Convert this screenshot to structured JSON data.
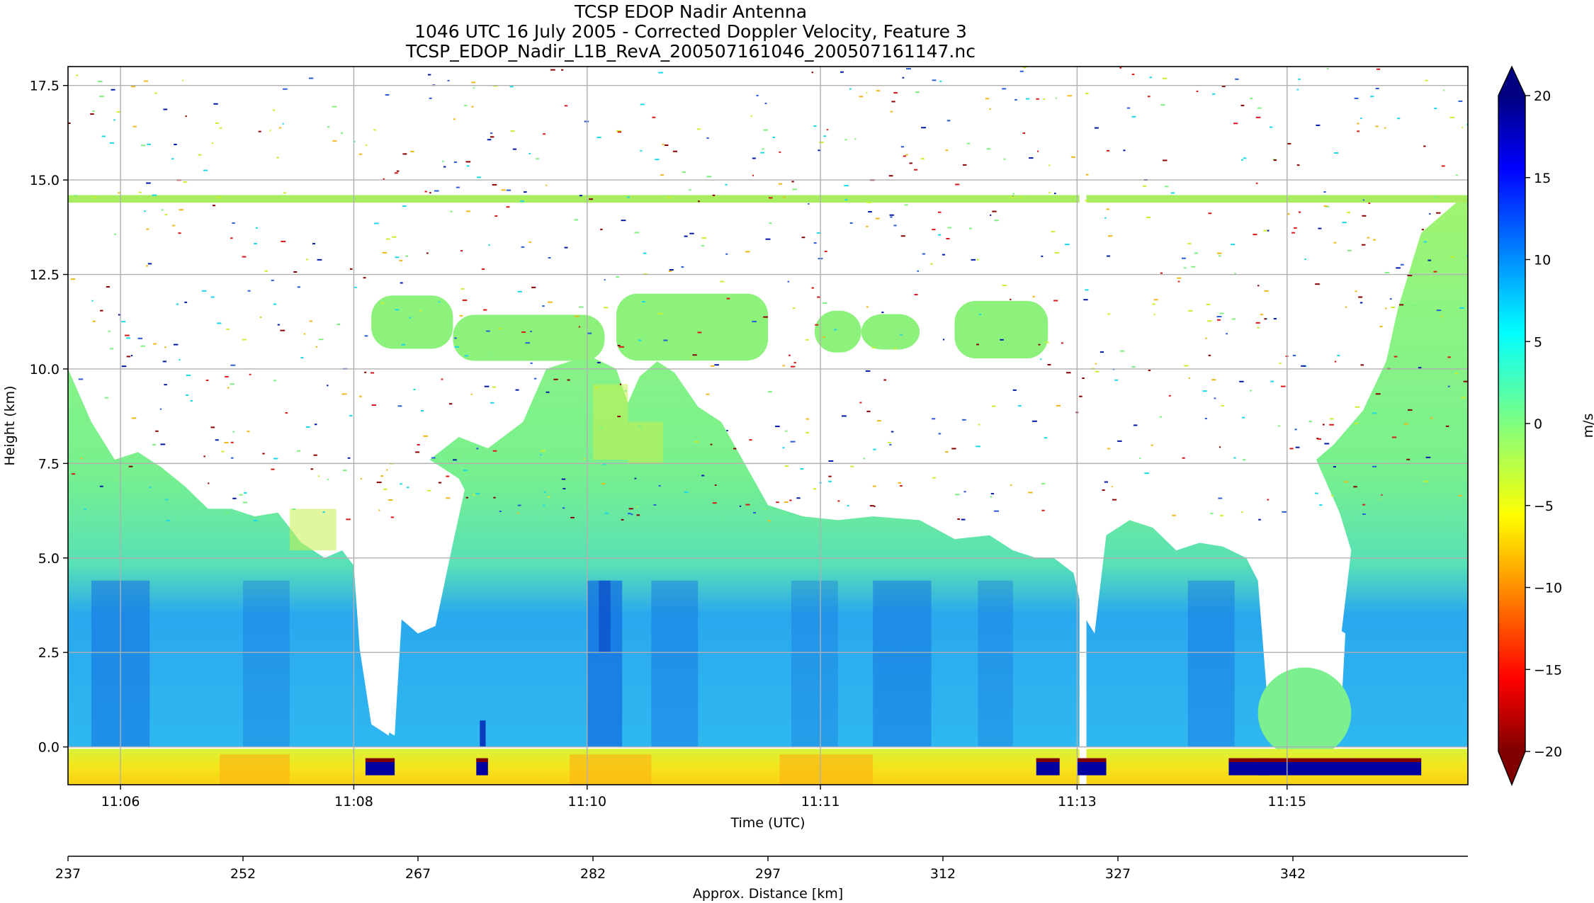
{
  "chart_data": {
    "type": "heatmap",
    "title": [
      "TCSP EDOP Nadir Antenna",
      "1046 UTC 16 July 2005 - Corrected Doppler Velocity, Feature 3",
      "TCSP_EDOP_Nadir_L1B_RevA_200507161046_200507161147.nc"
    ],
    "xlabel": "Time (UTC)",
    "ylabel": "Height (km)",
    "secondary_xlabel": "Approx. Distance [km]",
    "colorbar_label": "m/s",
    "colormap": "jet",
    "ylim": [
      -1.0,
      18.0
    ],
    "y_ticks": [
      {
        "v": 0.0,
        "label": "0.0"
      },
      {
        "v": 2.5,
        "label": "2.5"
      },
      {
        "v": 5.0,
        "label": "5.0"
      },
      {
        "v": 7.5,
        "label": "7.5"
      },
      {
        "v": 10.0,
        "label": "10.0"
      },
      {
        "v": 12.5,
        "label": "12.5"
      },
      {
        "v": 15.0,
        "label": "15.0"
      },
      {
        "v": 17.5,
        "label": "17.5"
      }
    ],
    "distance_range": [
      237,
      357
    ],
    "time_ticks": [
      {
        "d": 241.5,
        "label": "11:06"
      },
      {
        "d": 261.5,
        "label": "11:08"
      },
      {
        "d": 281.5,
        "label": "11:10"
      },
      {
        "d": 301.5,
        "label": "11:11"
      },
      {
        "d": 323.5,
        "label": "11:13"
      },
      {
        "d": 341.5,
        "label": "11:15"
      }
    ],
    "distance_ticks": [
      {
        "d": 237,
        "label": "237"
      },
      {
        "d": 252,
        "label": "252"
      },
      {
        "d": 267,
        "label": "267"
      },
      {
        "d": 282,
        "label": "282"
      },
      {
        "d": 297,
        "label": "297"
      },
      {
        "d": 312,
        "label": "312"
      },
      {
        "d": 327,
        "label": "327"
      },
      {
        "d": 342,
        "label": "342"
      }
    ],
    "colorbar_range": [
      -20,
      20
    ],
    "colorbar_ticks": [
      {
        "v": 20,
        "label": "20"
      },
      {
        "v": 15,
        "label": "15"
      },
      {
        "v": 10,
        "label": "10"
      },
      {
        "v": 5,
        "label": "5"
      },
      {
        "v": 0,
        "label": "0"
      },
      {
        "v": -5,
        "label": "−5"
      },
      {
        "v": -10,
        "label": "−10"
      },
      {
        "v": -15,
        "label": "−15"
      },
      {
        "v": -20,
        "label": "−20"
      }
    ],
    "grid": true,
    "echo_top_profile_km": [
      {
        "d": 237.0,
        "top": 10.0
      },
      {
        "d": 239.0,
        "top": 8.6
      },
      {
        "d": 241.0,
        "top": 7.6
      },
      {
        "d": 243.0,
        "top": 7.8
      },
      {
        "d": 245.0,
        "top": 7.4
      },
      {
        "d": 247.0,
        "top": 6.9
      },
      {
        "d": 249.0,
        "top": 6.3
      },
      {
        "d": 251.0,
        "top": 6.3
      },
      {
        "d": 253.0,
        "top": 6.1
      },
      {
        "d": 255.0,
        "top": 6.2
      },
      {
        "d": 257.0,
        "top": 5.4
      },
      {
        "d": 259.0,
        "top": 5.0
      },
      {
        "d": 260.5,
        "top": 5.2
      },
      {
        "d": 261.5,
        "top": 4.8
      },
      {
        "d": 262.0,
        "top": 2.6
      },
      {
        "d": 263.0,
        "top": 0.6
      },
      {
        "d": 264.5,
        "top": 0.3
      },
      {
        "d": 265.5,
        "top": 3.4
      },
      {
        "d": 267.0,
        "top": 3.0
      },
      {
        "d": 268.5,
        "top": 3.2
      },
      {
        "d": 270.0,
        "top": 5.4
      },
      {
        "d": 271.0,
        "top": 6.8
      },
      {
        "d": 270.5,
        "top": 7.1
      },
      {
        "d": 268.0,
        "top": 7.6
      },
      {
        "d": 270.5,
        "top": 8.2
      },
      {
        "d": 273.0,
        "top": 7.9
      },
      {
        "d": 276.0,
        "top": 8.6
      },
      {
        "d": 278.0,
        "top": 10.0
      },
      {
        "d": 280.0,
        "top": 10.2
      },
      {
        "d": 282.0,
        "top": 10.3
      },
      {
        "d": 284.0,
        "top": 10.0
      },
      {
        "d": 285.0,
        "top": 9.1
      },
      {
        "d": 286.0,
        "top": 9.8
      },
      {
        "d": 287.5,
        "top": 10.2
      },
      {
        "d": 289.0,
        "top": 9.9
      },
      {
        "d": 291.0,
        "top": 9.0
      },
      {
        "d": 293.0,
        "top": 8.6
      },
      {
        "d": 295.0,
        "top": 7.5
      },
      {
        "d": 297.0,
        "top": 6.4
      },
      {
        "d": 300.0,
        "top": 6.1
      },
      {
        "d": 303.0,
        "top": 6.0
      },
      {
        "d": 306.0,
        "top": 6.1
      },
      {
        "d": 310.0,
        "top": 6.0
      },
      {
        "d": 313.0,
        "top": 5.5
      },
      {
        "d": 316.0,
        "top": 5.6
      },
      {
        "d": 318.0,
        "top": 5.2
      },
      {
        "d": 320.0,
        "top": 5.0
      },
      {
        "d": 321.5,
        "top": 5.0
      },
      {
        "d": 323.2,
        "top": 4.6
      },
      {
        "d": 324.0,
        "top": 3.5
      },
      {
        "d": 325.0,
        "top": 3.0
      },
      {
        "d": 326.0,
        "top": 5.6
      },
      {
        "d": 328.0,
        "top": 6.0
      },
      {
        "d": 330.0,
        "top": 5.8
      },
      {
        "d": 332.0,
        "top": 5.2
      },
      {
        "d": 334.0,
        "top": 5.4
      },
      {
        "d": 336.0,
        "top": 5.3
      },
      {
        "d": 338.0,
        "top": 5.0
      },
      {
        "d": 339.0,
        "top": 4.4
      },
      {
        "d": 340.0,
        "top": 0.5
      },
      {
        "d": 341.5,
        "top": 1.2
      },
      {
        "d": 343.0,
        "top": 1.4
      },
      {
        "d": 344.5,
        "top": 1.0
      },
      {
        "d": 346.0,
        "top": 2.6
      },
      {
        "d": 347.0,
        "top": 5.2
      },
      {
        "d": 346.0,
        "top": 6.2
      },
      {
        "d": 344.0,
        "top": 7.6
      },
      {
        "d": 345.5,
        "top": 8.0
      },
      {
        "d": 348.0,
        "top": 8.9
      },
      {
        "d": 350.0,
        "top": 10.2
      },
      {
        "d": 351.0,
        "top": 11.6
      },
      {
        "d": 353.0,
        "top": 13.6
      },
      {
        "d": 356.0,
        "top": 14.4
      },
      {
        "d": 357.0,
        "top": 14.6
      }
    ],
    "anvil_layer_km": [
      10.2,
      12.0
    ],
    "noise_line_km": 14.5,
    "ground_level_km": 0.0,
    "strong_updraft_cores_km": [
      282.5,
      283.5
    ],
    "surface_clutter_segments_km": [
      [
        262.5,
        265
      ],
      [
        272,
        273
      ],
      [
        320,
        322
      ],
      [
        323.5,
        326
      ],
      [
        336.5,
        340
      ],
      [
        339,
        353
      ]
    ]
  }
}
